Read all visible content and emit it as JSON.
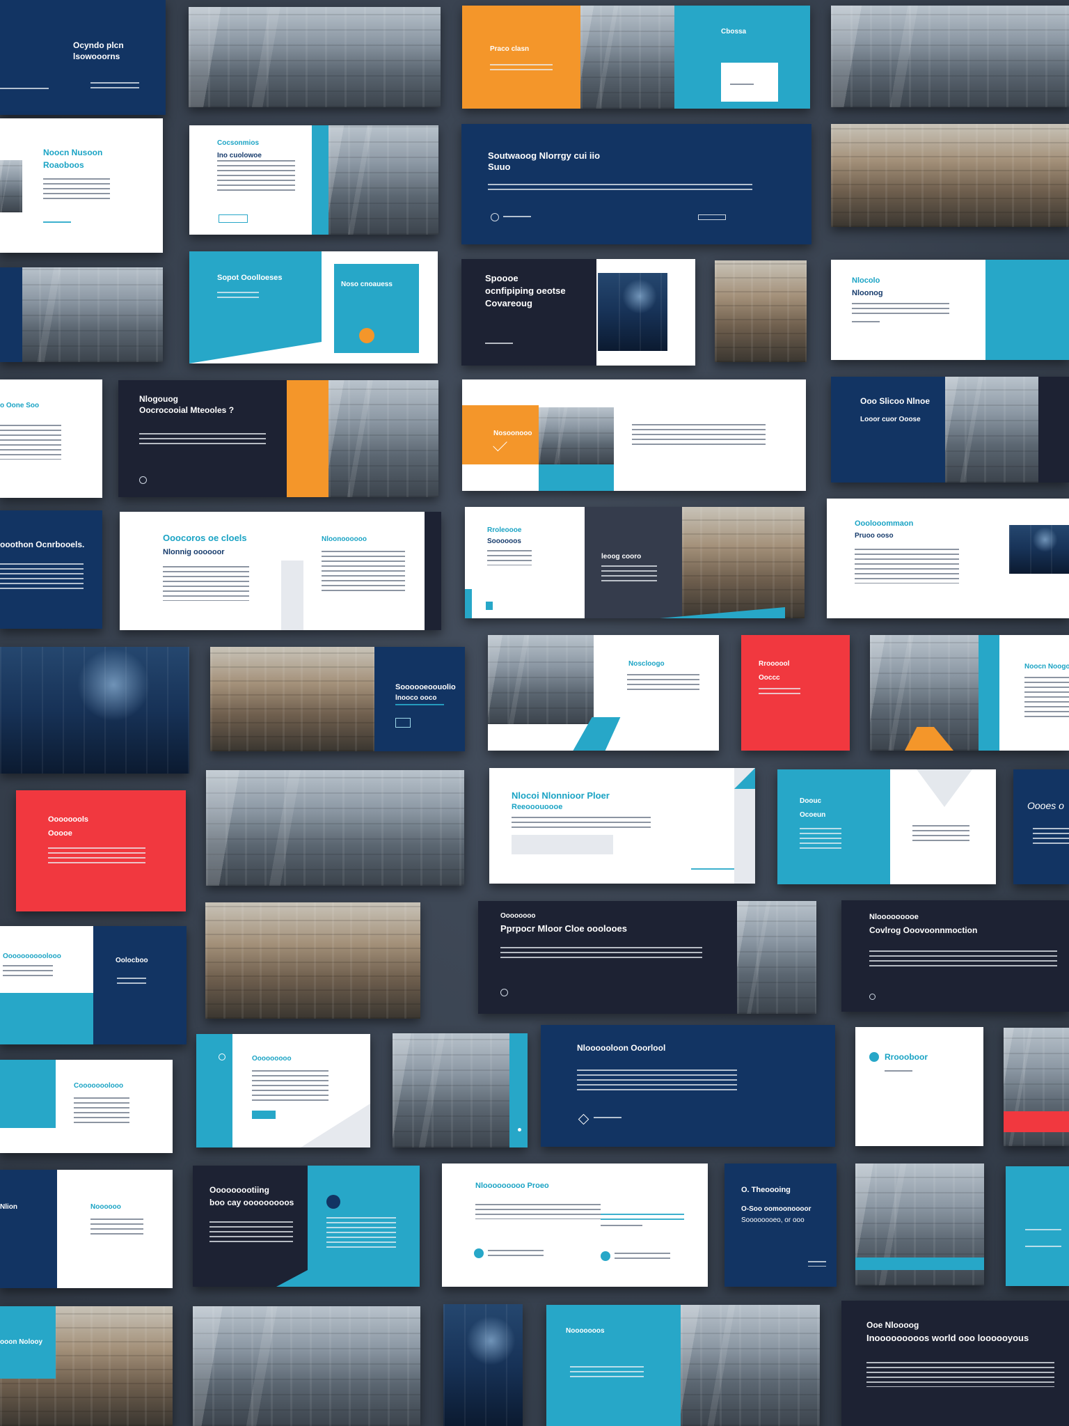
{
  "titles": {
    "r1c1": [
      "Ocyndo plcn",
      "lsowooorns"
    ],
    "r1c3_orange": "Praco clasn",
    "r1c3_teal": "Cbossa",
    "r2c1": [
      "Noocn Nusoon",
      "Roaoboos"
    ],
    "r2c2": [
      "Cocsonmios",
      "Ino cuolowoe"
    ],
    "r2c3": [
      "Soutwaoog Nlorrgy cui iio",
      "Suuo"
    ],
    "r3c2": [
      "Sopot Ooolloeses",
      "Noso cnoauess"
    ],
    "r3c3": [
      "Spoooe",
      "ocnfipiping oeotse",
      "Covareoug"
    ],
    "r3c4": [
      "Nlocolo",
      "Nloonog"
    ],
    "r4c1": "o Oone Soo",
    "r4c2": [
      "Nlogouog",
      "Oocrocooial Mteooles ?"
    ],
    "r4c3": "Nosoonooo",
    "r4c4": [
      "Ooo Slicoo Nlnoe",
      "Looor cuor Ooose"
    ],
    "r5c1": "ooothon Ocnrbooels.",
    "r5c2": [
      "Ooocoros oe cloels",
      "Nlonnig oooooor"
    ],
    "r5c2b": "Nloonoooooo",
    "r5c3": [
      "Rroleoooe",
      "Soooooos"
    ],
    "r5c3b": "leoog cooro",
    "r5c4": [
      "Ooolooommaon",
      "Pruoo ooso"
    ],
    "r6c2": [
      "Soooooeoouolio",
      "lnooco ooco"
    ],
    "r6c3": "Noscloogo",
    "r6c4_red": [
      "Rroooool",
      "Ooccc"
    ],
    "r6c5": "Noocn Noogo",
    "r7c1": [
      "Oooooools",
      "Ooooe"
    ],
    "r7c2": [
      "Nlocoi Nlonnioor Ploer",
      "Reeooouoooe"
    ],
    "r7c3": [
      "Doouc",
      "Ocoeun"
    ],
    "r7c4": "Oooes o",
    "r8c1": [
      "Oooooooooolooo",
      "Oolocboo"
    ],
    "r8c2": [
      "Oooooooo",
      "Pprpocr Mloor Cloe ooolooes"
    ],
    "r8c3": [
      "Nlooooooooe",
      "Covlrog Ooovoonnmoction"
    ],
    "r9c1": "Cooooooolooo",
    "r9c2": "Ooooooooo",
    "r9c3": "Nloooooloon Ooorlool",
    "r9c4": "Rroooboor",
    "r10c1": "Nlion",
    "r10c2": "Noooooo",
    "r10c3": [
      "Ooooooootiing",
      "boo cay ooooooooos"
    ],
    "r10c4": "Nlooooooooo Proeo",
    "r10c5": [
      "O. Theoooing",
      "O-Soo oomoonoooor",
      "Soooooooeo, or ooo"
    ],
    "r11c1": "ooon Nolooy",
    "r11c3": "Nooooooos",
    "r11c4": [
      "Ooe Nloooog",
      "Inooooooooos world ooo loooooyous"
    ]
  },
  "icons": [
    "chevron-down-icon",
    "arrow-circle-icon",
    "diamond-icon",
    "dot-icon"
  ],
  "colors": {
    "background": "#3a4452",
    "navy": "#123463",
    "dark": "#1d2233",
    "teal": "#27a7c8",
    "orange": "#f4962a",
    "red": "#f1383f",
    "white": "#ffffff"
  }
}
